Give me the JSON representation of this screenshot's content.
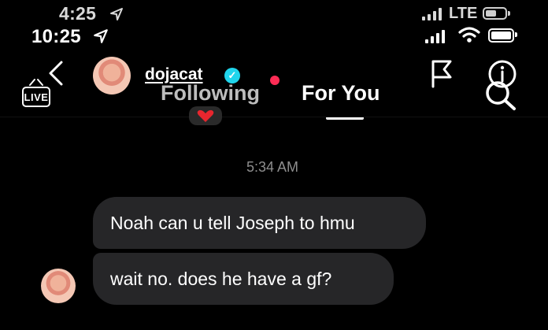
{
  "status_bar": {
    "back_time": "4:25",
    "front_time": "10:25",
    "network": "LTE"
  },
  "nav": {
    "live_label": "LIVE",
    "tabs": [
      {
        "label": "Following",
        "active": false
      },
      {
        "label": "For You",
        "active": true
      }
    ]
  },
  "chat_header": {
    "username": "dojacat",
    "verified": true
  },
  "conversation": {
    "timestamp": "5:34 AM",
    "messages": [
      {
        "text": "Noah can u tell Joseph to hmu"
      },
      {
        "text": "wait no. does he have a gf?"
      }
    ]
  },
  "colors": {
    "background": "#000000",
    "bubble": "#262628",
    "accent_red": "#fe2c55",
    "verified_blue": "#20d5ec"
  },
  "icons": [
    "location-arrow-icon",
    "signal-icon",
    "wifi-icon",
    "battery-icon",
    "back-chevron-icon",
    "live-tv-icon",
    "flag-icon",
    "info-icon",
    "search-icon",
    "heart-icon",
    "verified-icon"
  ]
}
